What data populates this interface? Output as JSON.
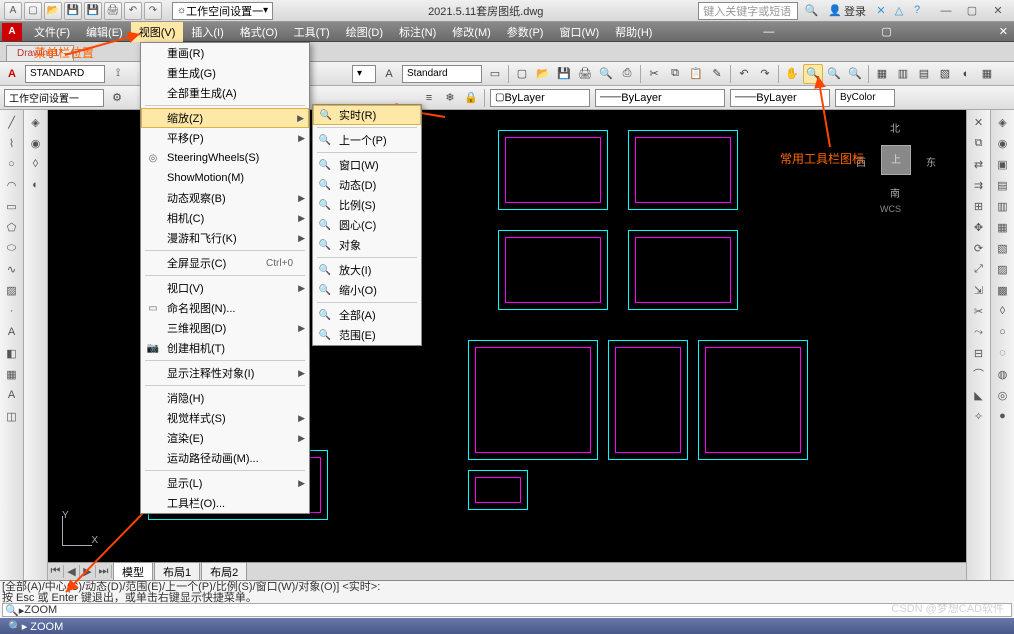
{
  "title": "2021.5.11套房图纸.dwg",
  "workspace": "工作空间设置一",
  "search_placeholder": "键入关键字或短语",
  "login": "登录",
  "menus": [
    "文件(F)",
    "编辑(E)",
    "视图(V)",
    "插入(I)",
    "格式(O)",
    "工具(T)",
    "绘图(D)",
    "标注(N)",
    "修改(M)",
    "参数(P)",
    "窗口(W)",
    "帮助(H)"
  ],
  "doc_tab": "Drawing1*",
  "anno_toolbar_label": "菜单栏位置",
  "anno_right_label": "常用工具栏图标",
  "style_combo1": "STANDARD",
  "style_combo2": "Standard",
  "layer_combo": "ByLayer",
  "linew_combo": "ByLayer",
  "lt_combo": "ByLayer",
  "color_combo": "ByColor",
  "viewcube": {
    "top": "上",
    "n": "北",
    "s": "南",
    "e": "东",
    "w": "西",
    "wcs": "WCS"
  },
  "view_menu": {
    "items": [
      {
        "label": "重画(R)",
        "icon": ""
      },
      {
        "label": "重生成(G)",
        "icon": ""
      },
      {
        "label": "全部重生成(A)",
        "icon": ""
      },
      {
        "sep": true
      },
      {
        "label": "缩放(Z)",
        "icon": "",
        "sub": true,
        "sel": true
      },
      {
        "label": "平移(P)",
        "icon": "",
        "sub": true
      },
      {
        "label": "SteeringWheels(S)",
        "icon": "◎"
      },
      {
        "label": "ShowMotion(M)",
        "icon": ""
      },
      {
        "label": "动态观察(B)",
        "icon": "",
        "sub": true
      },
      {
        "label": "相机(C)",
        "icon": "",
        "sub": true
      },
      {
        "label": "漫游和飞行(K)",
        "icon": "",
        "sub": true
      },
      {
        "sep": true
      },
      {
        "label": "全屏显示(C)",
        "shortcut": "Ctrl+0"
      },
      {
        "sep": true
      },
      {
        "label": "视口(V)",
        "sub": true
      },
      {
        "label": "命名视图(N)...",
        "icon": "▭"
      },
      {
        "label": "三维视图(D)",
        "sub": true
      },
      {
        "label": "创建相机(T)",
        "icon": "📷"
      },
      {
        "sep": true
      },
      {
        "label": "显示注释性对象(I)",
        "sub": true
      },
      {
        "sep": true
      },
      {
        "label": "消隐(H)",
        "icon": ""
      },
      {
        "label": "视觉样式(S)",
        "sub": true
      },
      {
        "label": "渲染(E)",
        "sub": true
      },
      {
        "label": "运动路径动画(M)..."
      },
      {
        "sep": true
      },
      {
        "label": "显示(L)",
        "sub": true
      },
      {
        "label": "工具栏(O)..."
      }
    ]
  },
  "zoom_submenu": [
    {
      "label": "实时(R)",
      "icon": "🔍",
      "sel": true
    },
    {
      "sep": true
    },
    {
      "label": "上一个(P)",
      "icon": "🔍"
    },
    {
      "sep": true
    },
    {
      "label": "窗口(W)",
      "icon": "🔍"
    },
    {
      "label": "动态(D)",
      "icon": "🔍"
    },
    {
      "label": "比例(S)",
      "icon": "🔍"
    },
    {
      "label": "圆心(C)",
      "icon": "🔍"
    },
    {
      "label": "对象",
      "icon": "🔍"
    },
    {
      "sep": true
    },
    {
      "label": "放大(I)",
      "icon": "🔍"
    },
    {
      "label": "缩小(O)",
      "icon": "🔍"
    },
    {
      "sep": true
    },
    {
      "label": "全部(A)",
      "icon": "🔍"
    },
    {
      "label": "范围(E)",
      "icon": "🔍"
    }
  ],
  "layout_tabs": [
    "模型",
    "布局1",
    "布局2"
  ],
  "cmd_history1": "[全部(A)/中心(C)/动态(D)/范围(E)/上一个(P)/比例(S)/窗口(W)/对象(O)] <实时>:",
  "cmd_history2": "按 Esc 或 Enter 键退出，或单击右键显示快捷菜单。",
  "cmd_prompt": "ZOOM",
  "status_cmd": "ZOOM",
  "watermark": "CSDN @梦想CAD软件"
}
